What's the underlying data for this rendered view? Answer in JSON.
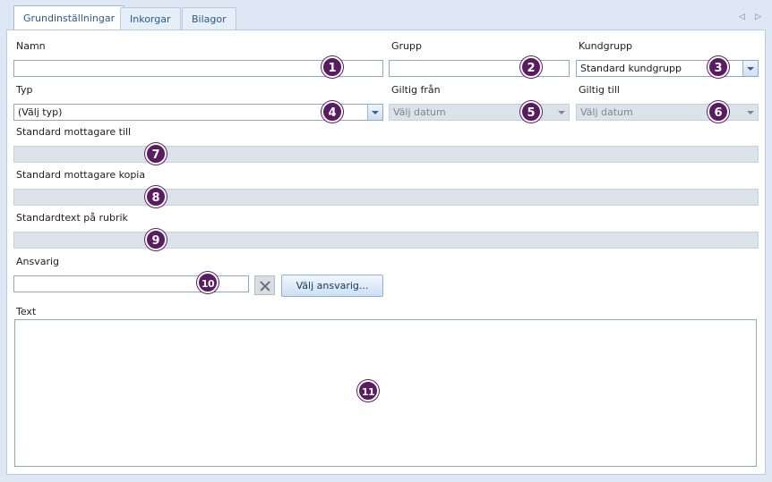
{
  "tabs": [
    "Grundinställningar",
    "Inkorgar",
    "Bilagor"
  ],
  "form": {
    "namn": {
      "label": "Namn",
      "value": "",
      "marker": "1"
    },
    "grupp": {
      "label": "Grupp",
      "value": "",
      "marker": "2"
    },
    "kundgrupp": {
      "label": "Kundgrupp",
      "value": "Standard kundgrupp",
      "marker": "3"
    },
    "typ": {
      "label": "Typ",
      "value": "(Välj typ)",
      "marker": "4"
    },
    "giltig_fran": {
      "label": "Giltig från",
      "placeholder": "Välj datum",
      "marker": "5"
    },
    "giltig_till": {
      "label": "Giltig till",
      "placeholder": "Välj datum",
      "marker": "6"
    },
    "mottagare_till": {
      "label": "Standard mottagare till",
      "marker": "7"
    },
    "mottagare_kopia": {
      "label": "Standard mottagare kopia",
      "marker": "8"
    },
    "standardtext": {
      "label": "Standardtext på rubrik",
      "marker": "9"
    },
    "ansvarig": {
      "label": "Ansvarig",
      "value": "",
      "marker": "10",
      "button_label": "Välj ansvarig..."
    },
    "text": {
      "label": "Text",
      "marker": "11"
    }
  },
  "colors": {
    "marker": "#5a1c61",
    "accent": "#2a5a8e",
    "disabled": "#dbe2ea"
  },
  "icons": {
    "clear": "close-icon",
    "tab_prev": "chevron-left-icon",
    "tab_next": "chevron-right-icon"
  }
}
